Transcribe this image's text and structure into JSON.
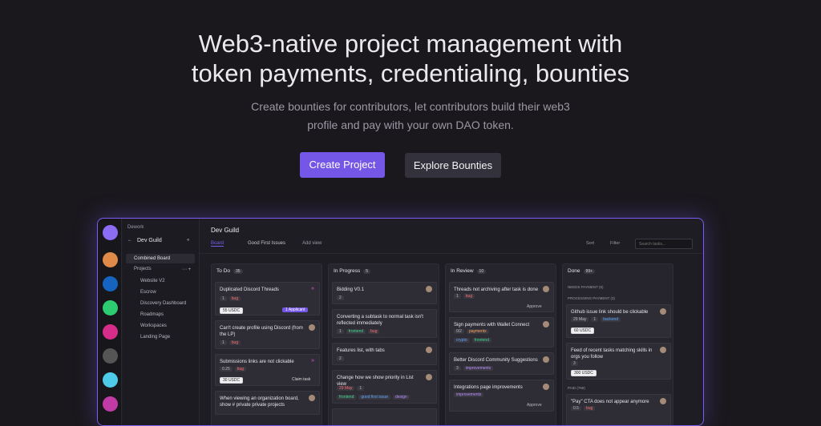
{
  "hero": {
    "title_line1": "Web3-native project management with",
    "title_line2": "token payments, credentialing, bounties",
    "subtitle_line1": "Create bounties for contributors, let contributors build their web3",
    "subtitle_line2": "profile and pay with your own DAO token.",
    "primary_cta": "Create Project",
    "secondary_cta": "Explore Bounties"
  },
  "app": {
    "brand": "Dework",
    "back": "←",
    "org_name": "Dev Guild",
    "collapse": "«",
    "combined_board": "Combined Board",
    "projects_label": "Projects",
    "projects_actions": "⋯  +",
    "projects": [
      "Website V2",
      "Escrow",
      "Discovery Dashboard",
      "Roadmaps",
      "Workspaces",
      "Landing Page"
    ],
    "project_title": "Dev Guild",
    "tabs": [
      "Board",
      "Good First Issues",
      "Add view"
    ],
    "sort": "Sort",
    "filter": "Filter",
    "search_placeholder": "Search tasks...",
    "colors": {
      "accent": "#7457e6",
      "border": "#7c5cf0",
      "bug": "#ff6b6b",
      "backend": "#5aa6ff",
      "frontend": "#39d98a",
      "design": "#b98cff"
    }
  },
  "columns": [
    {
      "name": "To Do",
      "count": "35",
      "cards": [
        {
          "title": "Duplicated Discord Threads",
          "meta": [
            "1",
            "bug"
          ],
          "usdc": "55 USDC",
          "badge": "1 Applicant"
        },
        {
          "title": "Can't create profile using Discord (from the LP)",
          "meta": [
            "1",
            "bug"
          ]
        },
        {
          "title": "Submissions links are not clickable",
          "meta": [
            "0.25",
            "bug"
          ],
          "usdc": "30 USDC",
          "action": "Claim task"
        },
        {
          "title": "When viewing an organization board, show # private private projects",
          "meta": []
        }
      ]
    },
    {
      "name": "In Progress",
      "count": "5",
      "cards": [
        {
          "title": "Bidding V0.1",
          "meta": [
            "2"
          ]
        },
        {
          "title": "Converting a subtask to normal task isn't reflected immediately",
          "meta": [
            "1",
            "frontend",
            "bug"
          ]
        },
        {
          "title": "Features list, with tabs",
          "meta": [
            "2"
          ]
        },
        {
          "title": "Change how we show priority in List view",
          "meta": [
            "29 May",
            "1"
          ],
          "tags": [
            "frontend",
            "good first issue",
            "design"
          ]
        },
        {
          "title": "",
          "meta": []
        }
      ]
    },
    {
      "name": "In Review",
      "count": "10",
      "cards": [
        {
          "title": "Threads not archiving after task is done",
          "meta": [
            "1",
            "bug"
          ],
          "action": "Approve"
        },
        {
          "title": "Sign payments with Wallet Connect",
          "meta": [
            "0/2",
            "payments"
          ],
          "tags": [
            "crypto",
            "frontend"
          ]
        },
        {
          "title": "Better Discord Community Suggestions",
          "meta": [
            "3",
            "improvements"
          ]
        },
        {
          "title": "Integrations page improvements",
          "meta": [
            "improvements"
          ],
          "action": "Approve"
        }
      ]
    },
    {
      "name": "Done",
      "count": "99+",
      "needs_payment": "NEEDS PAYMENT (6)",
      "processing": "PROCESSING PAYMENT (3)",
      "paid": "PAID (768)",
      "cards": [
        {
          "title": "Github issue link should be clickable",
          "meta": [
            "29 May",
            "1",
            "backend"
          ],
          "usdc": "60 USDC"
        },
        {
          "title": "Feed of recent tasks matching skills in orgs you follow",
          "meta": [
            "3"
          ],
          "usdc": "300 USDC"
        },
        {
          "title": "\"Pay\" CTA does not appear anymore",
          "meta": [
            "0.5",
            "bug"
          ]
        }
      ]
    }
  ]
}
